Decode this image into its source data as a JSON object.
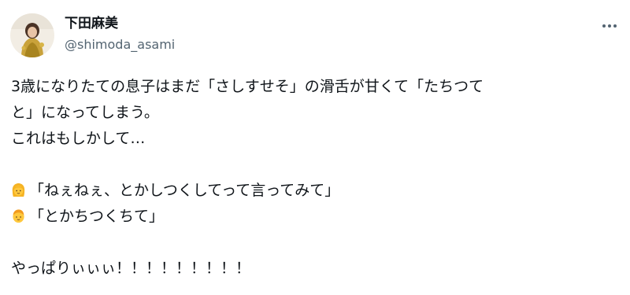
{
  "author": {
    "display_name": "下田麻美",
    "handle": "@shimoda_asami",
    "avatar_icon": "profile-photo-avatar"
  },
  "menu": {
    "more_icon": "more-horizontal-icon"
  },
  "tweet": {
    "line1": "3歳になりたての息子はまだ「さしすせそ」の滑舌が甘くて「たちつて",
    "line2": "と」になってしまう。",
    "line3": "これはもしかして…",
    "quote1": "「ねぇねぇ、とかしつくしてって言ってみて」",
    "quote2": "「とかちつくちて」",
    "closing": "やっぱりぃぃぃ！！！！！！！！！",
    "emoji_woman": "woman-face-emoji",
    "emoji_boy": "boy-face-emoji"
  },
  "colors": {
    "text": "#0f1419",
    "secondary": "#536471"
  }
}
